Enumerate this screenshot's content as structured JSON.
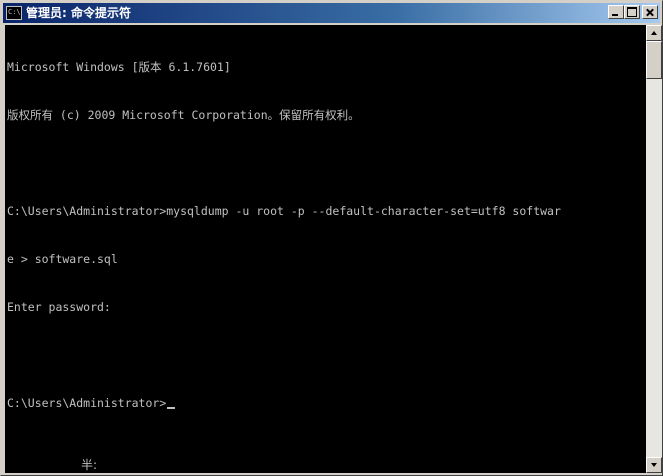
{
  "window": {
    "title": "管理员: 命令提示符",
    "icon": "console-icon"
  },
  "title_buttons": {
    "minimize": "minimize-icon",
    "maximize": "maximize-icon",
    "close": "close-icon"
  },
  "console": {
    "lines": [
      "Microsoft Windows [版本 6.1.7601]",
      "版权所有 (c) 2009 Microsoft Corporation。保留所有权利。",
      "",
      "C:\\Users\\Administrator>mysqldump -u root -p --default-character-set=utf8 softwar",
      "e > software.sql",
      "Enter password:",
      "",
      "C:\\Users\\Administrator>"
    ],
    "ime_status": "半:"
  },
  "colors": {
    "console_bg": "#000000",
    "console_fg": "#c0c0c0",
    "titlebar_start": "#0a246a",
    "titlebar_end": "#a6caf0",
    "chrome": "#d4d0c8"
  },
  "scrollbar": {
    "up": "scroll-up-arrow-icon",
    "down": "scroll-down-arrow-icon"
  }
}
